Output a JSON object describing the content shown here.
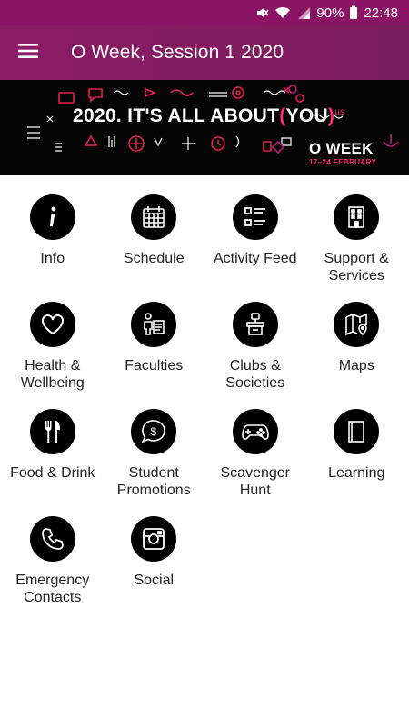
{
  "status_bar": {
    "battery": "90%",
    "time": "22:48"
  },
  "app_bar": {
    "title": "O Week, Session 1 2020",
    "menu_icon": "hamburger-menu-icon"
  },
  "banner": {
    "headline_prefix": "2020. IT'S ALL ABOUT",
    "headline_open": "(",
    "headline_you": "YOU",
    "headline_close": ")",
    "headline_super": "us",
    "event_title": "O WEEK",
    "event_dates": "17–24 FEBRUARY",
    "accent_color": "#ff2c73"
  },
  "tiles": [
    {
      "label": "Info",
      "icon": "info-icon"
    },
    {
      "label": "Schedule",
      "icon": "calendar-icon"
    },
    {
      "label": "Activity Feed",
      "icon": "list-icon"
    },
    {
      "label": "Support &\nServices",
      "icon": "building-icon"
    },
    {
      "label": "Health &\nWellbeing",
      "icon": "heart-icon"
    },
    {
      "label": "Faculties",
      "icon": "person-document-icon"
    },
    {
      "label": "Clubs &\nSocieties",
      "icon": "podium-icon"
    },
    {
      "label": "Maps",
      "icon": "map-pin-icon"
    },
    {
      "label": "Food & Drink",
      "icon": "fork-knife-icon"
    },
    {
      "label": "Student\nPromotions",
      "icon": "dollar-bubble-icon"
    },
    {
      "label": "Scavenger\nHunt",
      "icon": "gamepad-icon"
    },
    {
      "label": "Learning",
      "icon": "book-icon"
    },
    {
      "label": "Emergency\nContacts",
      "icon": "phone-icon"
    },
    {
      "label": "Social",
      "icon": "instagram-icon"
    }
  ],
  "colors": {
    "app_bar": "#8c1b65",
    "status_bar": "#8b1565",
    "icon_circle": "#000000"
  }
}
